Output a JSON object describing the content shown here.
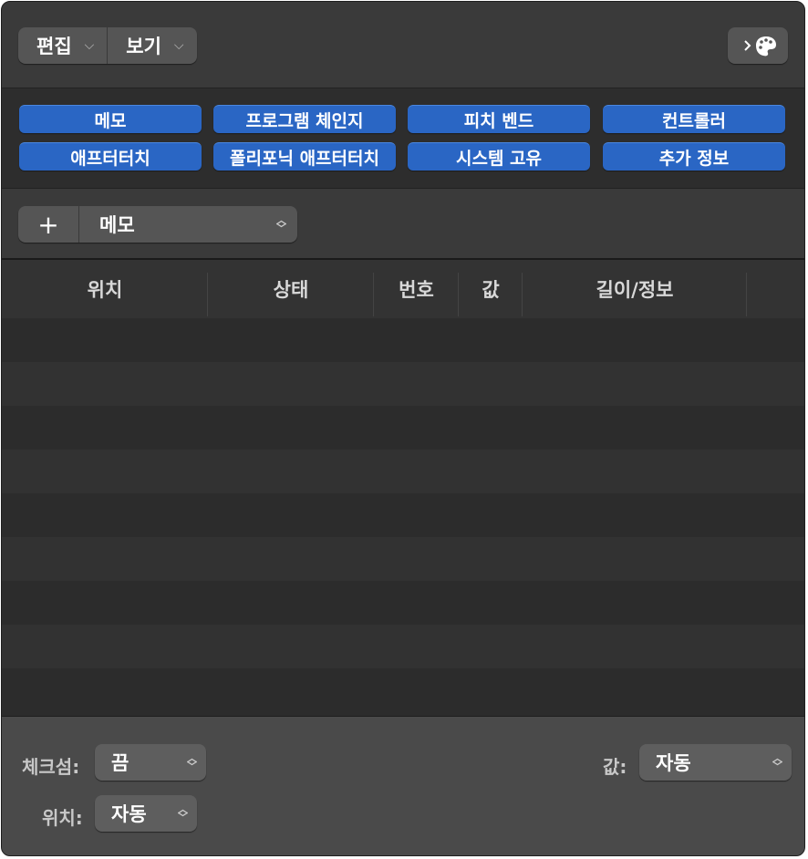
{
  "toolbar": {
    "edit_label": "편집",
    "view_label": "보기",
    "midi_icon": "midi-palette-icon"
  },
  "filters": [
    {
      "label": "메모"
    },
    {
      "label": "프로그램 체인지"
    },
    {
      "label": "피치 벤드"
    },
    {
      "label": "컨트롤러"
    },
    {
      "label": "애프터터치"
    },
    {
      "label": "폴리포닉 애프터터치"
    },
    {
      "label": "시스템 고유"
    },
    {
      "label": "추가 정보"
    }
  ],
  "create": {
    "plus": "+",
    "type_value": "메모"
  },
  "table": {
    "columns": [
      "위치",
      "상태",
      "번호",
      "값",
      "길이/정보"
    ],
    "row_count": 9
  },
  "bottom": {
    "checkpoint_label": "체크섬:",
    "checkpoint_value": "끔",
    "value_label": "값:",
    "value_value": "자동",
    "position_label": "위치:",
    "position_value": "자동"
  },
  "colors": {
    "accent": "#2a66c4",
    "panel": "#323232"
  }
}
